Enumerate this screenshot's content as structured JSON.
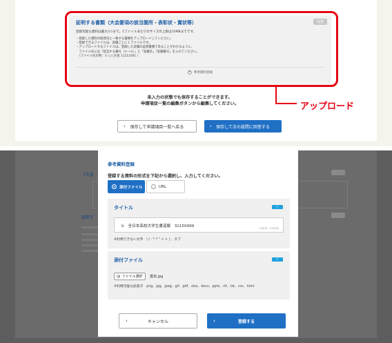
{
  "top": {
    "doc_title": "証明する書類（大会要項の該当箇所・表彰状・賞状等）",
    "badge": "任意",
    "limit_text": "登録可能な資料は最大3つまで。1ファイルあたりのサイズの上限は10MBまでです。",
    "notes": [
      "・登録した資料の取得日と一致する書類をアップロードしてください。",
      "・登録できるファイルは、実績ごとに１ファイルです。",
      "・アップロードするファイルは、登録した実績の証明書類であることがわかるように、",
      "　ファイル名には「該当する番号（①〜③）」と「実績名」「実績番号」を入れてください。",
      "　〔ファイル名の例：① ○○大会 11211001 〕"
    ],
    "ref_button": "参考資料登録",
    "callout": "アップロード",
    "message_line1": "未入力の状態でも保存することができます。",
    "message_line2": "申請項目一覧の編集ボタンから編集してください。",
    "back_button": "保存して申請項目一覧へ戻る",
    "next_button": "保存して次の設問に回答する"
  },
  "bottom_bg": {
    "title1": "【大会",
    "title2": "証明す",
    "badge": "任意"
  },
  "modal": {
    "title": "参考資料登録",
    "instruction": "登録する資料の形式を下記から選択し、入力してください。",
    "radio_file": "添付ファイル",
    "radio_url": "URL",
    "title_section": {
      "label": "タイトル",
      "value": "①　全日本高校大学生書道展　32150999",
      "counter": "23文字／100文字",
      "note": "※利用できない文字　\\ / : * ? \" < > | 、タブ"
    },
    "file_section": {
      "label": "添付ファイル",
      "select_button": "ファイル選択",
      "file_name": "賞状.jpg",
      "note": "※利用可能な拡張子　png、jpg、jpeg、gif、pdf、xlsx、docx、pptx、rtf、txt、csv、html"
    },
    "cancel_button": "キャンセル",
    "register_button": "登録する"
  }
}
